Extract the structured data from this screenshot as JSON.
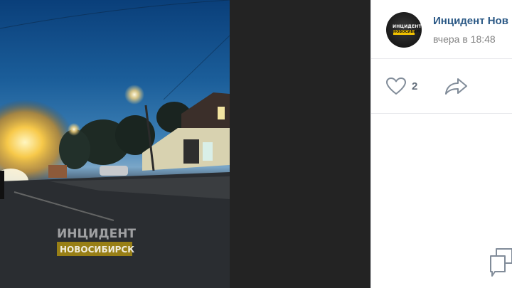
{
  "post": {
    "author_name": "Инцидент Нов",
    "timestamp": "вчера в 18:48",
    "likes_count": "2"
  },
  "avatar": {
    "line1": "ИНЦИДЕНТ",
    "line2": "НОВОСИБИРСК"
  },
  "photo": {
    "watermark_top": "ИНЦИДЕНТ",
    "watermark_bottom": "НОВОСИБИРСК"
  },
  "icons": {
    "like": "heart-outline-icon",
    "share": "share-arrow-icon",
    "comment": "comment-bubbles-icon"
  },
  "colors": {
    "link": "#2a5885",
    "muted": "#828282",
    "dark_background": "#232323",
    "watermark_yellow": "#f2c200"
  }
}
